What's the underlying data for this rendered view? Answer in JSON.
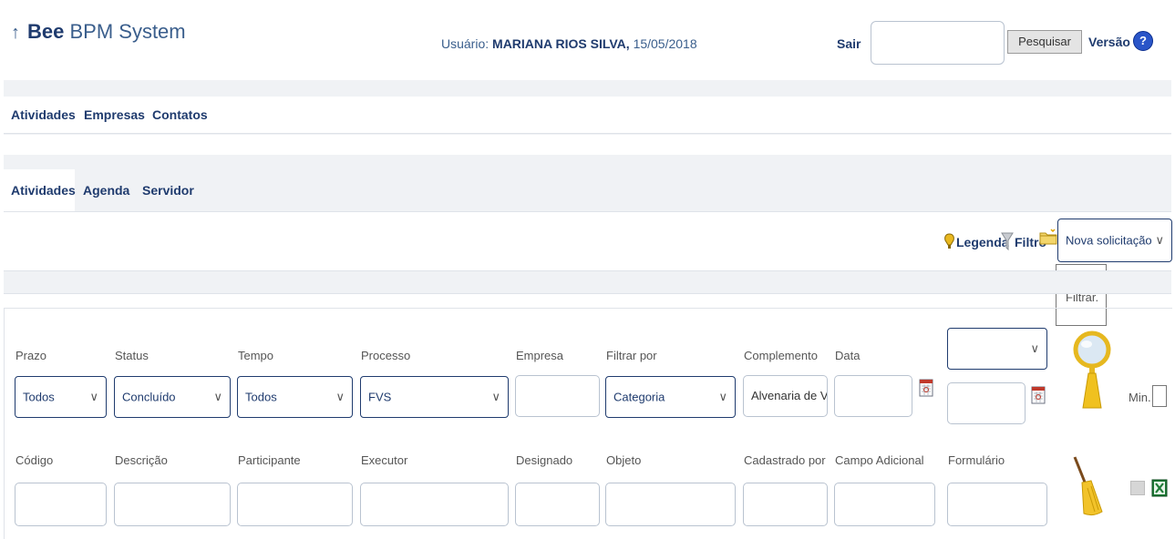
{
  "app": {
    "brand_bold": "Bee",
    "brand_rest": "BPM System",
    "arrow": "↑"
  },
  "header": {
    "user_label": "Usuário:",
    "user_name": "MARIANA RIOS SILVA,",
    "date": "15/05/2018",
    "sair_label": "Sair",
    "search_value": "",
    "search_button": "Pesquisar",
    "versao_label": "Versão",
    "help_icon": "help-icon"
  },
  "main_nav": {
    "items": [
      "Atividades",
      "Empresas",
      "Contatos"
    ]
  },
  "sub_nav": {
    "items": [
      "Atividades",
      "Agenda",
      "Servidor"
    ]
  },
  "toolbar": {
    "legenda_label": "Legenda",
    "filtro_label": "Filtro",
    "nova_select": "Nova solicitação",
    "tooltip": "Filtrar."
  },
  "filters": {
    "row1_labels": {
      "prazo": "Prazo",
      "status": "Status",
      "tempo": "Tempo",
      "processo": "Processo",
      "empresa": "Empresa",
      "filtrar_por": "Filtrar por",
      "complemento": "Complemento",
      "data": "Data"
    },
    "row1_values": {
      "prazo": "Todos",
      "status": "Concluído",
      "tempo": "Todos",
      "processo": "FVS",
      "empresa": "",
      "filtrar_por": "Categoria",
      "complemento": "Alvenaria de V ",
      "data": "",
      "data_select": "",
      "data2": ""
    },
    "min_label": "Min.",
    "row2_labels": {
      "codigo": "Código",
      "descricao": "Descrição",
      "participante": "Participante",
      "executor": "Executor",
      "designado": "Designado",
      "objeto": "Objeto",
      "cadastrado_por": "Cadastrado por",
      "campo_adicional": "Campo Adicional",
      "formulario": "Formulário"
    }
  },
  "colors": {
    "primary": "#1f3b6e",
    "band": "#f0f2f5",
    "field_border": "#b9c3d0",
    "excel_green": "#1e7a36"
  }
}
